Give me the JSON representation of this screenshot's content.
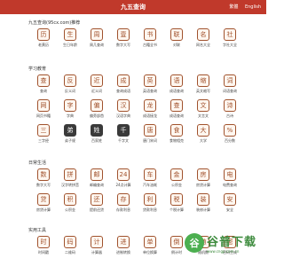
{
  "header": {
    "title": "九五查询",
    "links": [
      "繁體",
      "English"
    ]
  },
  "sections": [
    {
      "title": "九五查询(95cx.com)推荐",
      "items": [
        {
          "label": "老黄历",
          "glyph": "历"
        },
        {
          "label": "生日年龄",
          "glyph": "生"
        },
        {
          "label": "周几查询",
          "glyph": "周"
        },
        {
          "label": "数字大写",
          "glyph": "壹"
        },
        {
          "label": "古籍全书",
          "glyph": "书"
        },
        {
          "label": "对联",
          "glyph": "联"
        },
        {
          "label": "网名大全",
          "glyph": "名"
        },
        {
          "label": "字社大全",
          "glyph": "社"
        }
      ]
    },
    {
      "title": "学习教育",
      "items": [
        {
          "label": "查询",
          "glyph": "查"
        },
        {
          "label": "反义词",
          "glyph": "反"
        },
        {
          "label": "近义词",
          "glyph": "近"
        },
        {
          "label": "查询成语",
          "glyph": "成"
        },
        {
          "label": "英语查询",
          "glyph": "英"
        },
        {
          "label": "成语查询",
          "glyph": "语"
        },
        {
          "label": "英文缩写",
          "glyph": "缩"
        },
        {
          "label": "词语查询",
          "glyph": "词"
        },
        {
          "label": "网页书籍",
          "glyph": "网"
        },
        {
          "label": "字典",
          "glyph": "字"
        },
        {
          "label": "偏旁部首",
          "glyph": "偏"
        },
        {
          "label": "汉语字典",
          "glyph": "汉"
        },
        {
          "label": "成语接龙",
          "glyph": "龙"
        },
        {
          "label": "成语查询",
          "glyph": "查"
        },
        {
          "label": "文言文",
          "glyph": "文"
        },
        {
          "label": "古诗",
          "glyph": "诗"
        },
        {
          "label": "三字经",
          "glyph": "三"
        },
        {
          "label": "弟子规",
          "glyph": "弟",
          "dark": true
        },
        {
          "label": "百家姓",
          "glyph": "姓",
          "dark": true
        },
        {
          "label": "千字文",
          "glyph": "千",
          "dark": true
        },
        {
          "label": "唐门宋词",
          "glyph": "唐"
        },
        {
          "label": "食物相克",
          "glyph": "食"
        },
        {
          "label": "大学",
          "glyph": "大"
        },
        {
          "label": "百分数",
          "glyph": "%"
        }
      ]
    },
    {
      "title": "日常生活",
      "items": [
        {
          "label": "数字大写",
          "glyph": "数"
        },
        {
          "label": "汉字转拼音",
          "glyph": "拼"
        },
        {
          "label": "邮编查询",
          "glyph": "邮"
        },
        {
          "label": "24点计算",
          "glyph": "24"
        },
        {
          "label": "汽车油耗",
          "glyph": "车"
        },
        {
          "label": "公积金",
          "glyph": "金"
        },
        {
          "label": "房贷计算",
          "glyph": "房"
        },
        {
          "label": "电费查询",
          "glyph": "电"
        },
        {
          "label": "房贷计算",
          "glyph": "贷"
        },
        {
          "label": "公积金",
          "glyph": "积"
        },
        {
          "label": "提前还贷",
          "glyph": "还"
        },
        {
          "label": "存款利息",
          "glyph": "存"
        },
        {
          "label": "贷款利息",
          "glyph": "利"
        },
        {
          "label": "个税计算",
          "glyph": "税"
        },
        {
          "label": "装修计算",
          "glyph": "装"
        },
        {
          "label": "安全",
          "glyph": "安"
        }
      ]
    },
    {
      "title": "实用工具",
      "items": [
        {
          "label": "时间戳",
          "glyph": "时"
        },
        {
          "label": "二维码",
          "glyph": "码"
        },
        {
          "label": "计算器",
          "glyph": "计"
        },
        {
          "label": "进制转换",
          "glyph": "进"
        },
        {
          "label": "单位换算",
          "glyph": "单"
        },
        {
          "label": "倒计时",
          "glyph": "倒"
        },
        {
          "label": "随机数",
          "glyph": "随"
        },
        {
          "label": "密码生成",
          "glyph": "密"
        }
      ]
    }
  ],
  "watermark": {
    "cn": "谷普下载",
    "en": "www.cngp.com.cn",
    "logo": "谷"
  }
}
